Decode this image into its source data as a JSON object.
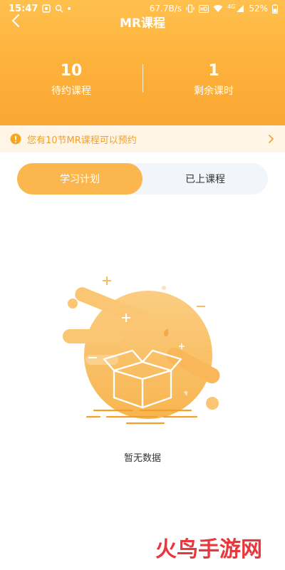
{
  "status_bar": {
    "time": "15:47",
    "network_speed": "67.7B/s",
    "network_type": "4G",
    "battery": "52%"
  },
  "nav": {
    "title": "MR课程"
  },
  "stats": [
    {
      "value": "10",
      "label": "待约课程"
    },
    {
      "value": "1",
      "label": "剩余课时"
    }
  ],
  "notice": {
    "text": "您有10节MR课程可以预约"
  },
  "tabs": [
    {
      "label": "学习计划",
      "active": true
    },
    {
      "label": "已上课程",
      "active": false
    }
  ],
  "empty_state": {
    "text": "暂无数据"
  },
  "watermark": {
    "text": "火鸟手游网"
  },
  "colors": {
    "header": "#fdb03a",
    "accent": "#fbb74e",
    "notice_bg": "#fff5e6",
    "notice_text": "#f2a02a",
    "tab_bg": "#f2f5fa"
  }
}
